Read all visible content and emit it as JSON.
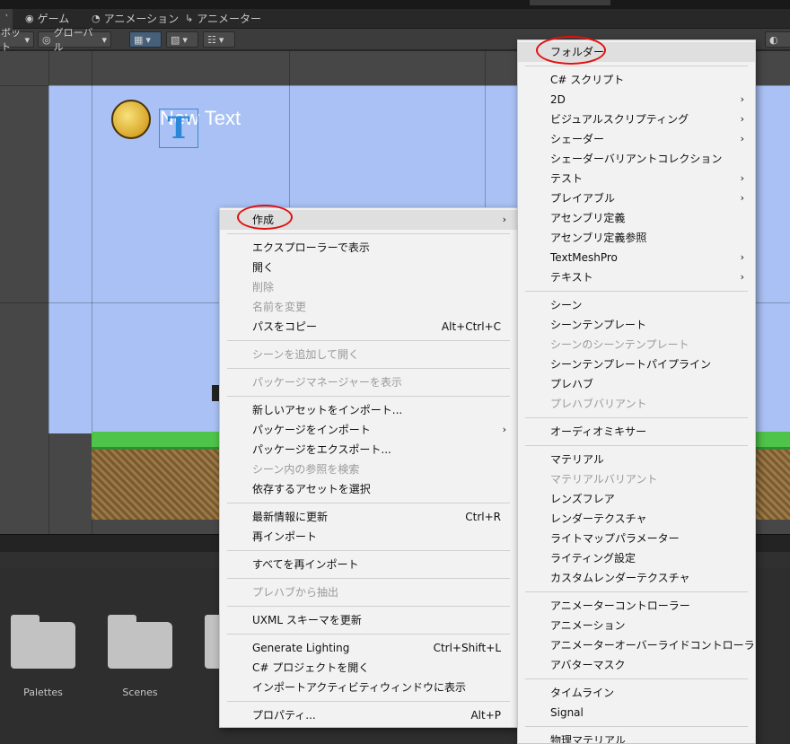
{
  "tabs": [
    {
      "label": "‵",
      "icon": ""
    },
    {
      "label": "ゲーム",
      "icon": "gamepad-icon"
    },
    {
      "label": "アニメーション",
      "icon": "clock-icon"
    },
    {
      "label": "アニメーター",
      "icon": "animator-icon"
    }
  ],
  "toolbar": {
    "pivot_label": "ボット",
    "global_label": "グローバル"
  },
  "scene": {
    "text_object": "New Text",
    "gizmo_letter": "T"
  },
  "project": {
    "folders": [
      "Palettes",
      "Scenes"
    ]
  },
  "context_menu": {
    "items": [
      {
        "label": "作成",
        "has_submenu": true,
        "highlighted": true
      },
      {
        "separator": true
      },
      {
        "label": "エクスプローラーで表示"
      },
      {
        "label": "開く"
      },
      {
        "label": "削除",
        "disabled": true
      },
      {
        "label": "名前を変更",
        "disabled": true
      },
      {
        "label": "パスをコピー",
        "shortcut": "Alt+Ctrl+C"
      },
      {
        "separator": true
      },
      {
        "label": "シーンを追加して開く",
        "disabled": true
      },
      {
        "separator": true
      },
      {
        "label": "パッケージマネージャーを表示",
        "disabled": true
      },
      {
        "separator": true
      },
      {
        "label": "新しいアセットをインポート..."
      },
      {
        "label": "パッケージをインポート",
        "has_submenu": true
      },
      {
        "label": "パッケージをエクスポート..."
      },
      {
        "label": "シーン内の参照を検索",
        "disabled": true
      },
      {
        "label": "依存するアセットを選択"
      },
      {
        "separator": true
      },
      {
        "label": "最新情報に更新",
        "shortcut": "Ctrl+R"
      },
      {
        "label": "再インポート"
      },
      {
        "separator": true
      },
      {
        "label": "すべてを再インポート"
      },
      {
        "separator": true
      },
      {
        "label": "プレハブから抽出",
        "disabled": true
      },
      {
        "separator": true
      },
      {
        "label": "UXML スキーマを更新"
      },
      {
        "separator": true
      },
      {
        "label": "Generate Lighting",
        "shortcut": "Ctrl+Shift+L"
      },
      {
        "label": "C# プロジェクトを開く"
      },
      {
        "label": "インポートアクティビティウィンドウに表示"
      },
      {
        "separator": true
      },
      {
        "label": "プロパティ...",
        "shortcut": "Alt+P"
      }
    ]
  },
  "create_submenu": {
    "items": [
      {
        "label": "フォルダー",
        "highlighted": true
      },
      {
        "separator": true
      },
      {
        "label": "C# スクリプト"
      },
      {
        "label": "2D",
        "has_submenu": true
      },
      {
        "label": "ビジュアルスクリプティング",
        "has_submenu": true
      },
      {
        "label": "シェーダー",
        "has_submenu": true
      },
      {
        "label": "シェーダーバリアントコレクション"
      },
      {
        "label": "テスト",
        "has_submenu": true
      },
      {
        "label": "プレイアブル",
        "has_submenu": true
      },
      {
        "label": "アセンブリ定義"
      },
      {
        "label": "アセンブリ定義参照"
      },
      {
        "label": "TextMeshPro",
        "has_submenu": true
      },
      {
        "label": "テキスト",
        "has_submenu": true
      },
      {
        "separator": true
      },
      {
        "label": "シーン"
      },
      {
        "label": "シーンテンプレート"
      },
      {
        "label": "シーンのシーンテンプレート",
        "disabled": true
      },
      {
        "label": "シーンテンプレートパイプライン"
      },
      {
        "label": "プレハブ"
      },
      {
        "label": "プレハブバリアント",
        "disabled": true
      },
      {
        "separator": true
      },
      {
        "label": "オーディオミキサー"
      },
      {
        "separator": true
      },
      {
        "label": "マテリアル"
      },
      {
        "label": "マテリアルバリアント",
        "disabled": true
      },
      {
        "label": "レンズフレア"
      },
      {
        "label": "レンダーテクスチャ"
      },
      {
        "label": "ライトマップパラメーター"
      },
      {
        "label": "ライティング設定"
      },
      {
        "label": "カスタムレンダーテクスチャ"
      },
      {
        "separator": true
      },
      {
        "label": "アニメーターコントローラー"
      },
      {
        "label": "アニメーション"
      },
      {
        "label": "アニメーターオーバーライドコントローラー"
      },
      {
        "label": "アバターマスク"
      },
      {
        "separator": true
      },
      {
        "label": "タイムライン"
      },
      {
        "label": "Signal"
      },
      {
        "separator": true
      },
      {
        "label": "物理マテリアル"
      }
    ]
  },
  "colors": {
    "annotation_red": "#e01010",
    "menu_bg": "#f2f2f2",
    "sky": "#a9c1f4"
  }
}
